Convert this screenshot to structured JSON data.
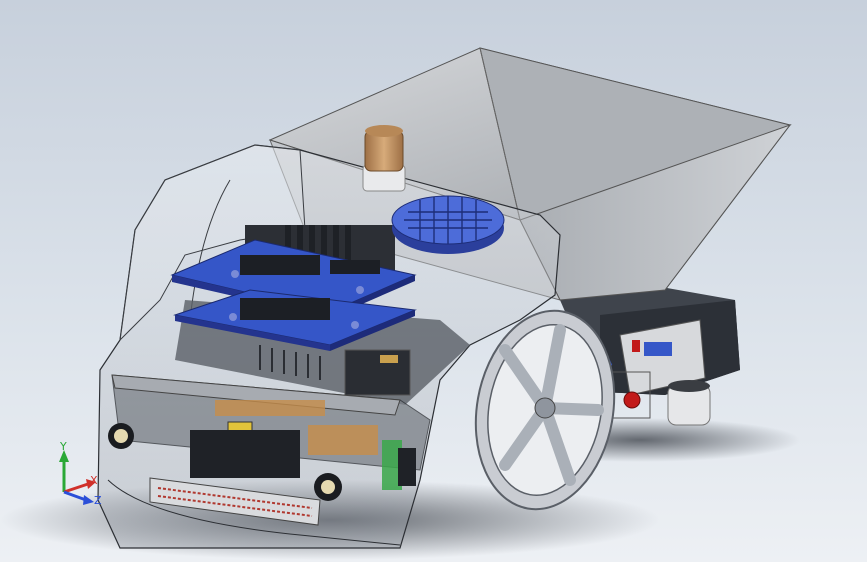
{
  "viewport": {
    "background_top": "#c7d0dc",
    "background_bottom": "#edf0f4"
  },
  "model": {
    "name_icon": "robot-assembly-icon",
    "colors": {
      "hopper": "#b7b9bd",
      "board": "#3556c8",
      "board_dark": "#24348e",
      "wheel": "#c9ccd2",
      "knob": "#c79a6a",
      "button_red": "#c21a1a",
      "chassis_shadow": "#4a4f57"
    }
  },
  "triad": {
    "y_label": "Y",
    "x_label": "X",
    "z_label": "Z",
    "y_color": "#2aa836",
    "x_color": "#d0302a",
    "z_color": "#2b4fd8"
  }
}
